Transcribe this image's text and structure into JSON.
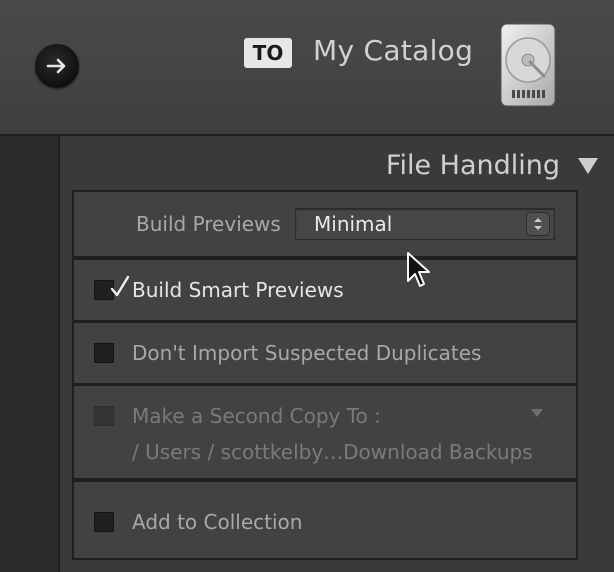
{
  "top_bar": {
    "to_badge": "TO",
    "catalog_name": "My Catalog"
  },
  "panel": {
    "title": "File Handling",
    "build_previews": {
      "label": "Build Previews",
      "value": "Minimal"
    },
    "options": [
      {
        "label": "Build Smart Previews",
        "checked": true
      },
      {
        "label": "Don't Import Suspected Duplicates",
        "checked": false
      },
      {
        "label": "Make a Second Copy To :",
        "path": "/ Users / scottkelby…Download Backups",
        "checked": false,
        "enabled": false
      },
      {
        "label": "Add to Collection",
        "checked": false
      }
    ]
  },
  "icons": {
    "arrow": "arrow-right-icon",
    "drive": "hard-drive-icon",
    "cursor": "mouse-pointer-icon"
  },
  "colors": {
    "panel_bg": "#3a3a3a",
    "box_bg": "#424242",
    "text_light": "#d0d0d0",
    "text_dim": "#7a7a7a"
  }
}
